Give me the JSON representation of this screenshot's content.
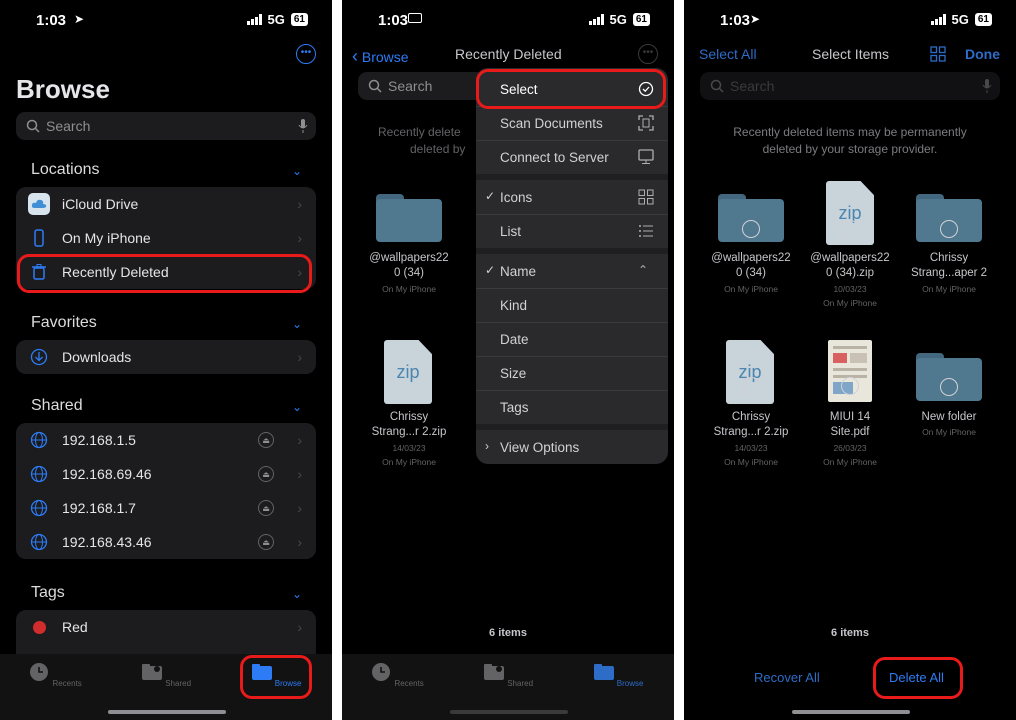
{
  "panel1": {
    "status": {
      "time": "1:03",
      "network": "5G",
      "battery": "61"
    },
    "title": "Browse",
    "search_placeholder": "Search",
    "locations": {
      "title": "Locations",
      "items": [
        {
          "label": "iCloud Drive"
        },
        {
          "label": "On My iPhone"
        },
        {
          "label": "Recently Deleted"
        }
      ]
    },
    "favorites": {
      "title": "Favorites",
      "items": [
        {
          "label": "Downloads"
        }
      ]
    },
    "shared": {
      "title": "Shared",
      "items": [
        {
          "label": "192.168.1.5"
        },
        {
          "label": "192.168.69.46"
        },
        {
          "label": "192.168.1.7"
        },
        {
          "label": "192.168.43.46"
        }
      ]
    },
    "tags": {
      "title": "Tags",
      "items": [
        {
          "label": "Red",
          "color": "#d12d2d"
        }
      ]
    },
    "tabs": [
      {
        "label": "Recents"
      },
      {
        "label": "Shared"
      },
      {
        "label": "Browse"
      }
    ]
  },
  "panel2": {
    "status": {
      "time": "1:03",
      "network": "5G",
      "battery": "61"
    },
    "back_label": "Browse",
    "title": "Recently Deleted",
    "search_placeholder": "Search",
    "note_line1": "Recently delete",
    "note_line2": "deleted by",
    "menu": {
      "select": "Select",
      "scan": "Scan Documents",
      "connect": "Connect to Server",
      "icons": "Icons",
      "list": "List",
      "name": "Name",
      "kind": "Kind",
      "date": "Date",
      "size": "Size",
      "tags": "Tags",
      "view_options": "View Options"
    },
    "files": [
      {
        "name1": "@wallpapers22",
        "name2": "0 (34)",
        "sub1": "On My iPhone"
      },
      {
        "name1": "Chrissy",
        "name2": "Strang...r 2.zip",
        "sub1": "14/03/23",
        "sub2": "On My iPhone",
        "zip": "zip"
      }
    ],
    "count": "6 items",
    "tabs": [
      {
        "label": "Recents"
      },
      {
        "label": "Shared"
      },
      {
        "label": "Browse"
      }
    ]
  },
  "panel3": {
    "status": {
      "time": "1:03",
      "network": "5G",
      "battery": "61"
    },
    "select_all": "Select All",
    "title": "Select Items",
    "done": "Done",
    "search_placeholder": "Search",
    "note_line1": "Recently deleted items may be permanently",
    "note_line2": "deleted by your storage provider.",
    "files": [
      {
        "name1": "@wallpapers22",
        "name2": "0 (34)",
        "sub1": "On My iPhone"
      },
      {
        "name1": "@wallpapers22",
        "name2": "0 (34).zip",
        "sub1": "10/03/23",
        "sub2": "On My iPhone",
        "zip": "zip"
      },
      {
        "name1": "Chrissy",
        "name2": "Strang...aper 2",
        "sub1": "On My iPhone"
      },
      {
        "name1": "Chrissy",
        "name2": "Strang...r 2.zip",
        "sub1": "14/03/23",
        "sub2": "On My iPhone",
        "zip": "zip"
      },
      {
        "name1": "MIUI 14",
        "name2": "Site.pdf",
        "sub1": "26/03/23",
        "sub2": "On My iPhone"
      },
      {
        "name1": "New folder",
        "sub1": "On My iPhone"
      }
    ],
    "count": "6 items",
    "recover_all": "Recover All",
    "delete_all": "Delete All"
  },
  "colors": {
    "accent": "#2d7cf6",
    "highlight": "#e81a1a",
    "background": "#000000"
  }
}
